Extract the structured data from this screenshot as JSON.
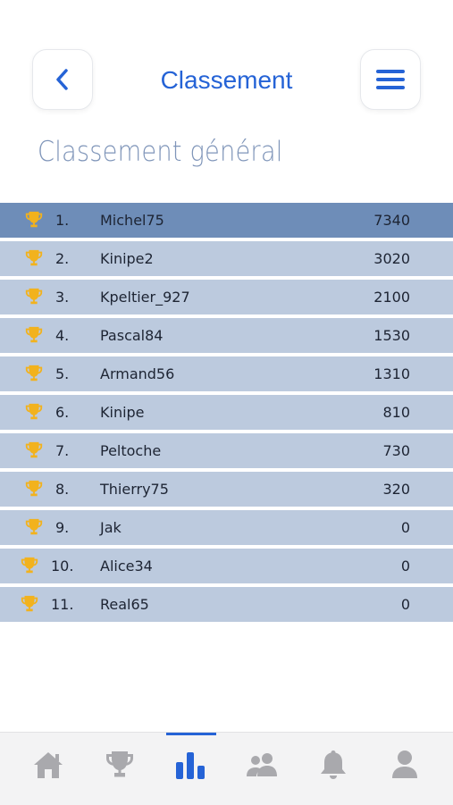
{
  "header": {
    "title": "Classement",
    "back_icon": "chevron-left-icon",
    "menu_icon": "hamburger-menu-icon"
  },
  "section": {
    "title": "Classement général"
  },
  "ranking": [
    {
      "rank": "1.",
      "name": "Michel75",
      "score": "7340"
    },
    {
      "rank": "2.",
      "name": "Kinipe2",
      "score": "3020"
    },
    {
      "rank": "3.",
      "name": "Kpeltier_927",
      "score": "2100"
    },
    {
      "rank": "4.",
      "name": "Pascal84",
      "score": "1530"
    },
    {
      "rank": "5.",
      "name": "Armand56",
      "score": "1310"
    },
    {
      "rank": "6.",
      "name": "Kinipe",
      "score": "810"
    },
    {
      "rank": "7.",
      "name": "Peltoche",
      "score": "730"
    },
    {
      "rank": "8.",
      "name": "Thierry75",
      "score": "320"
    },
    {
      "rank": "9.",
      "name": "Jak",
      "score": "0"
    },
    {
      "rank": "10.",
      "name": "Alice34",
      "score": "0"
    },
    {
      "rank": "11.",
      "name": "Real65",
      "score": "0"
    }
  ],
  "tabbar": {
    "tabs": [
      "home-icon",
      "trophy-icon",
      "ranking-icon",
      "friends-icon",
      "bell-icon",
      "profile-icon"
    ],
    "active": "ranking-icon"
  },
  "colors": {
    "accent": "#2563d6",
    "row": "#bccade",
    "row_highlight": "#6e8db8",
    "trophy": "#f2b21d",
    "tab_icon": "#a9a9ad"
  }
}
